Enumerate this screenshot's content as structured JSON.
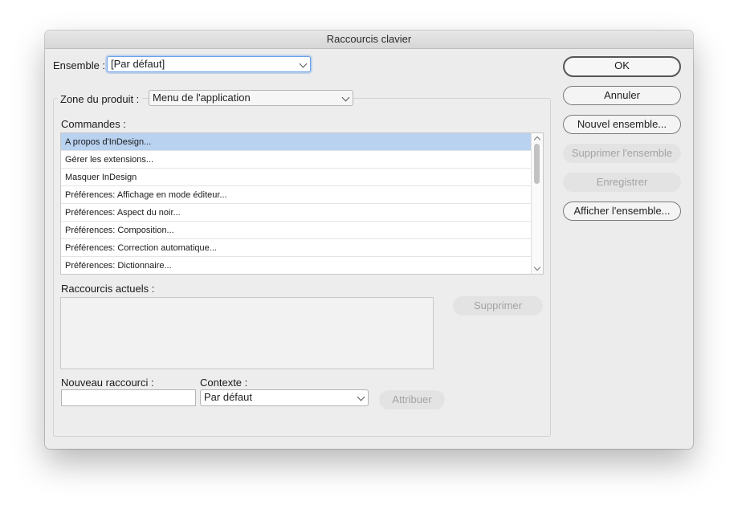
{
  "window": {
    "title": "Raccourcis clavier"
  },
  "ensemble": {
    "label": "Ensemble :",
    "value": "[Par défaut]"
  },
  "zone": {
    "label": "Zone du produit :",
    "value": "Menu de l'application"
  },
  "commandes": {
    "label": "Commandes :",
    "items": [
      "A propos d'InDesign...",
      "Gérer les extensions...",
      "Masquer InDesign",
      "Préférences: Affichage en mode éditeur...",
      "Préférences: Aspect du noir...",
      "Préférences: Composition...",
      "Préférences: Correction automatique...",
      "Préférences: Dictionnaire..."
    ],
    "selected_index": 0
  },
  "raccourcis_actuels": {
    "label": "Raccourcis actuels :"
  },
  "nouveau": {
    "label": "Nouveau raccourci :",
    "value": ""
  },
  "contexte": {
    "label": "Contexte :",
    "value": "Par défaut"
  },
  "buttons": {
    "ok": "OK",
    "annuler": "Annuler",
    "nouvel_ensemble": "Nouvel ensemble...",
    "supprimer_ensemble": "Supprimer l'ensemble",
    "enregistrer": "Enregistrer",
    "afficher_ensemble": "Afficher l'ensemble...",
    "supprimer": "Supprimer",
    "attribuer": "Attribuer"
  }
}
